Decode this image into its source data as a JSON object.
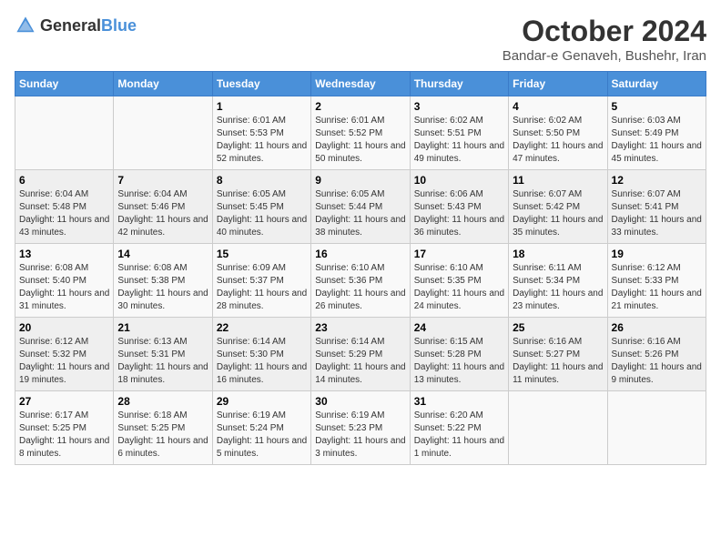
{
  "logo": {
    "text_general": "General",
    "text_blue": "Blue"
  },
  "title": "October 2024",
  "subtitle": "Bandar-e Genaveh, Bushehr, Iran",
  "days_of_week": [
    "Sunday",
    "Monday",
    "Tuesday",
    "Wednesday",
    "Thursday",
    "Friday",
    "Saturday"
  ],
  "weeks": [
    [
      {
        "day": "",
        "info": ""
      },
      {
        "day": "",
        "info": ""
      },
      {
        "day": "1",
        "info": "Sunrise: 6:01 AM\nSunset: 5:53 PM\nDaylight: 11 hours and 52 minutes."
      },
      {
        "day": "2",
        "info": "Sunrise: 6:01 AM\nSunset: 5:52 PM\nDaylight: 11 hours and 50 minutes."
      },
      {
        "day": "3",
        "info": "Sunrise: 6:02 AM\nSunset: 5:51 PM\nDaylight: 11 hours and 49 minutes."
      },
      {
        "day": "4",
        "info": "Sunrise: 6:02 AM\nSunset: 5:50 PM\nDaylight: 11 hours and 47 minutes."
      },
      {
        "day": "5",
        "info": "Sunrise: 6:03 AM\nSunset: 5:49 PM\nDaylight: 11 hours and 45 minutes."
      }
    ],
    [
      {
        "day": "6",
        "info": "Sunrise: 6:04 AM\nSunset: 5:48 PM\nDaylight: 11 hours and 43 minutes."
      },
      {
        "day": "7",
        "info": "Sunrise: 6:04 AM\nSunset: 5:46 PM\nDaylight: 11 hours and 42 minutes."
      },
      {
        "day": "8",
        "info": "Sunrise: 6:05 AM\nSunset: 5:45 PM\nDaylight: 11 hours and 40 minutes."
      },
      {
        "day": "9",
        "info": "Sunrise: 6:05 AM\nSunset: 5:44 PM\nDaylight: 11 hours and 38 minutes."
      },
      {
        "day": "10",
        "info": "Sunrise: 6:06 AM\nSunset: 5:43 PM\nDaylight: 11 hours and 36 minutes."
      },
      {
        "day": "11",
        "info": "Sunrise: 6:07 AM\nSunset: 5:42 PM\nDaylight: 11 hours and 35 minutes."
      },
      {
        "day": "12",
        "info": "Sunrise: 6:07 AM\nSunset: 5:41 PM\nDaylight: 11 hours and 33 minutes."
      }
    ],
    [
      {
        "day": "13",
        "info": "Sunrise: 6:08 AM\nSunset: 5:40 PM\nDaylight: 11 hours and 31 minutes."
      },
      {
        "day": "14",
        "info": "Sunrise: 6:08 AM\nSunset: 5:38 PM\nDaylight: 11 hours and 30 minutes."
      },
      {
        "day": "15",
        "info": "Sunrise: 6:09 AM\nSunset: 5:37 PM\nDaylight: 11 hours and 28 minutes."
      },
      {
        "day": "16",
        "info": "Sunrise: 6:10 AM\nSunset: 5:36 PM\nDaylight: 11 hours and 26 minutes."
      },
      {
        "day": "17",
        "info": "Sunrise: 6:10 AM\nSunset: 5:35 PM\nDaylight: 11 hours and 24 minutes."
      },
      {
        "day": "18",
        "info": "Sunrise: 6:11 AM\nSunset: 5:34 PM\nDaylight: 11 hours and 23 minutes."
      },
      {
        "day": "19",
        "info": "Sunrise: 6:12 AM\nSunset: 5:33 PM\nDaylight: 11 hours and 21 minutes."
      }
    ],
    [
      {
        "day": "20",
        "info": "Sunrise: 6:12 AM\nSunset: 5:32 PM\nDaylight: 11 hours and 19 minutes."
      },
      {
        "day": "21",
        "info": "Sunrise: 6:13 AM\nSunset: 5:31 PM\nDaylight: 11 hours and 18 minutes."
      },
      {
        "day": "22",
        "info": "Sunrise: 6:14 AM\nSunset: 5:30 PM\nDaylight: 11 hours and 16 minutes."
      },
      {
        "day": "23",
        "info": "Sunrise: 6:14 AM\nSunset: 5:29 PM\nDaylight: 11 hours and 14 minutes."
      },
      {
        "day": "24",
        "info": "Sunrise: 6:15 AM\nSunset: 5:28 PM\nDaylight: 11 hours and 13 minutes."
      },
      {
        "day": "25",
        "info": "Sunrise: 6:16 AM\nSunset: 5:27 PM\nDaylight: 11 hours and 11 minutes."
      },
      {
        "day": "26",
        "info": "Sunrise: 6:16 AM\nSunset: 5:26 PM\nDaylight: 11 hours and 9 minutes."
      }
    ],
    [
      {
        "day": "27",
        "info": "Sunrise: 6:17 AM\nSunset: 5:25 PM\nDaylight: 11 hours and 8 minutes."
      },
      {
        "day": "28",
        "info": "Sunrise: 6:18 AM\nSunset: 5:25 PM\nDaylight: 11 hours and 6 minutes."
      },
      {
        "day": "29",
        "info": "Sunrise: 6:19 AM\nSunset: 5:24 PM\nDaylight: 11 hours and 5 minutes."
      },
      {
        "day": "30",
        "info": "Sunrise: 6:19 AM\nSunset: 5:23 PM\nDaylight: 11 hours and 3 minutes."
      },
      {
        "day": "31",
        "info": "Sunrise: 6:20 AM\nSunset: 5:22 PM\nDaylight: 11 hours and 1 minute."
      },
      {
        "day": "",
        "info": ""
      },
      {
        "day": "",
        "info": ""
      }
    ]
  ]
}
